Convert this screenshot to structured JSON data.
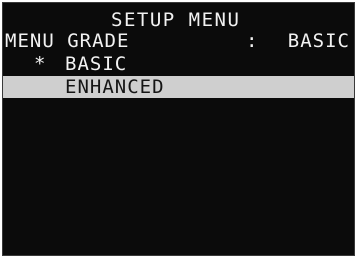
{
  "menu": {
    "title": "SETUP MENU",
    "grade": {
      "label": "MENU GRADE",
      "separator": ":",
      "value": "BASIC"
    },
    "options": [
      {
        "marker": "*",
        "label": "BASIC",
        "selected": true
      },
      {
        "marker": "",
        "label": "ENHANCED",
        "highlighted": true
      }
    ]
  },
  "colors": {
    "background": "#0b0b0b",
    "text": "#f2f2f2",
    "highlight_bar": "#cfcfcf",
    "highlight_text": "#151515"
  }
}
